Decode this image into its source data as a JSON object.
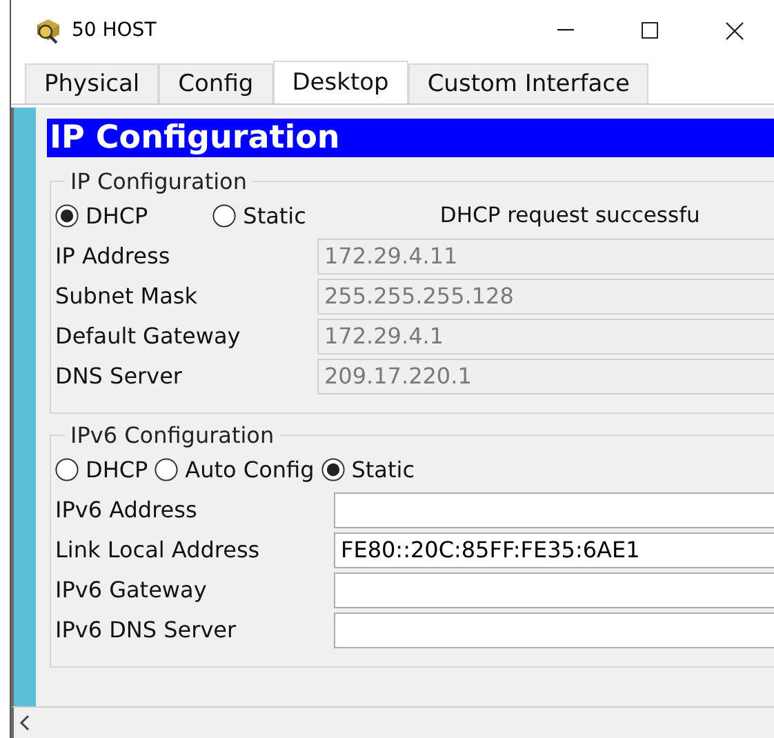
{
  "window": {
    "title": "50 HOST"
  },
  "tabs": [
    {
      "label": "Physical",
      "selected": false
    },
    {
      "label": "Config",
      "selected": false
    },
    {
      "label": "Desktop",
      "selected": true
    },
    {
      "label": "Custom Interface",
      "selected": false
    }
  ],
  "panel": {
    "title": "IP Configuration"
  },
  "sections": [
    {
      "legend": "IP Configuration",
      "modes": [
        {
          "label": "DHCP",
          "selected": true
        },
        {
          "label": "Static",
          "selected": false
        }
      ],
      "status": "DHCP request successfu",
      "fields": [
        {
          "label": "IP Address",
          "value": "172.29.4.11",
          "disabled": true
        },
        {
          "label": "Subnet Mask",
          "value": "255.255.255.128",
          "disabled": true
        },
        {
          "label": "Default Gateway",
          "value": "172.29.4.1",
          "disabled": true
        },
        {
          "label": "DNS Server",
          "value": "209.17.220.1",
          "disabled": true
        }
      ]
    },
    {
      "legend": "IPv6 Configuration",
      "modes": [
        {
          "label": "DHCP",
          "selected": false
        },
        {
          "label": "Auto Config",
          "selected": false
        },
        {
          "label": "Static",
          "selected": true
        }
      ],
      "fields": [
        {
          "label": "IPv6 Address",
          "disabled": false
        },
        {
          "label": "Link Local Address",
          "value": "FE80::20C:85FF:FE35:6AE1",
          "disabled": false
        },
        {
          "label": "IPv6 Gateway",
          "disabled": false
        },
        {
          "label": "IPv6 DNS Server",
          "disabled": false
        }
      ]
    }
  ]
}
